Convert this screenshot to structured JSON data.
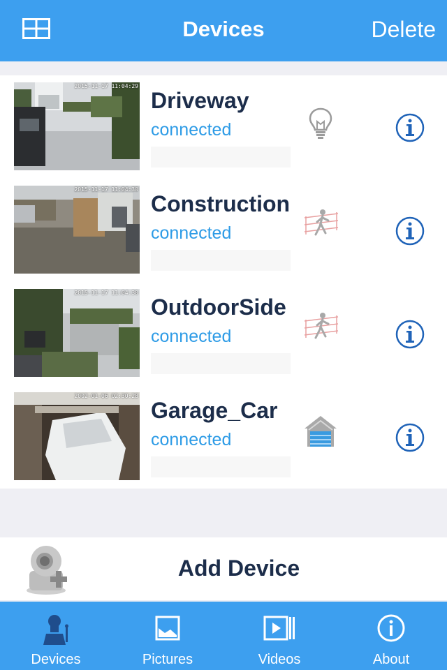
{
  "nav": {
    "title": "Devices",
    "delete_label": "Delete",
    "grid_icon": "grid-view-icon"
  },
  "devices": [
    {
      "name": "Driveway",
      "status": "connected",
      "timestamp": "2015-11-17 11:04:29",
      "feature_icon": "light-bulb-icon"
    },
    {
      "name": "Construction",
      "status": "connected",
      "timestamp": "2015-11-17 11:04:30",
      "feature_icon": "motion-detection-icon"
    },
    {
      "name": "OutdoorSide",
      "status": "connected",
      "timestamp": "2015-11-17 11:04:30",
      "feature_icon": "motion-detection-icon"
    },
    {
      "name": "Garage_Car",
      "status": "connected",
      "timestamp": "2002-01-06 02:30:28",
      "feature_icon": "garage-door-icon"
    }
  ],
  "add_device": {
    "label": "Add Device",
    "icon": "add-camera-icon"
  },
  "tabs": [
    {
      "label": "Devices",
      "icon": "camera-user-icon",
      "active": true
    },
    {
      "label": "Pictures",
      "icon": "picture-icon",
      "active": false
    },
    {
      "label": "Videos",
      "icon": "video-icon",
      "active": false
    },
    {
      "label": "About",
      "icon": "info-icon",
      "active": false
    }
  ],
  "colors": {
    "accent": "#3d9fef",
    "status": "#2d9be6",
    "text_dark": "#1c2d4a",
    "background": "#efeff4",
    "active_tab_icon": "#1f4d8c"
  }
}
